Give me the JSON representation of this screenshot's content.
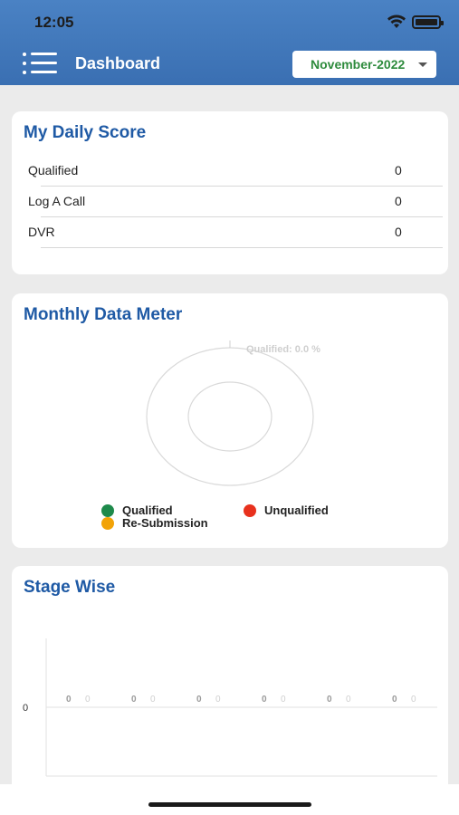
{
  "status_bar": {
    "time": "12:05"
  },
  "header": {
    "title": "Dashboard",
    "month_selected": "November-2022"
  },
  "daily_score": {
    "title": "My Daily Score",
    "rows": [
      {
        "label": "Qualified",
        "value": "0"
      },
      {
        "label": "Log A Call",
        "value": "0"
      },
      {
        "label": "DVR",
        "value": "0"
      }
    ]
  },
  "data_meter": {
    "title": "Monthly Data Meter",
    "callout": "Qualified: 0.0 %",
    "legend": [
      {
        "label": "Qualified",
        "color": "#1e8a4b"
      },
      {
        "label": "Unqualified",
        "color": "#e8311d"
      },
      {
        "label": "Re-Submission",
        "color": "#f2a307"
      }
    ]
  },
  "stage_wise": {
    "title": "Stage Wise",
    "y_tick": "0",
    "bar_labels": [
      {
        "value": "0",
        "alt": "0"
      },
      {
        "value": "0",
        "alt": "0"
      },
      {
        "value": "0",
        "alt": "0"
      },
      {
        "value": "0",
        "alt": "0"
      },
      {
        "value": "0",
        "alt": "0"
      },
      {
        "value": "0",
        "alt": "0"
      }
    ]
  },
  "colors": {
    "header": "#3d74b8",
    "title": "#1f5aa5",
    "month": "#2e8b3d"
  }
}
